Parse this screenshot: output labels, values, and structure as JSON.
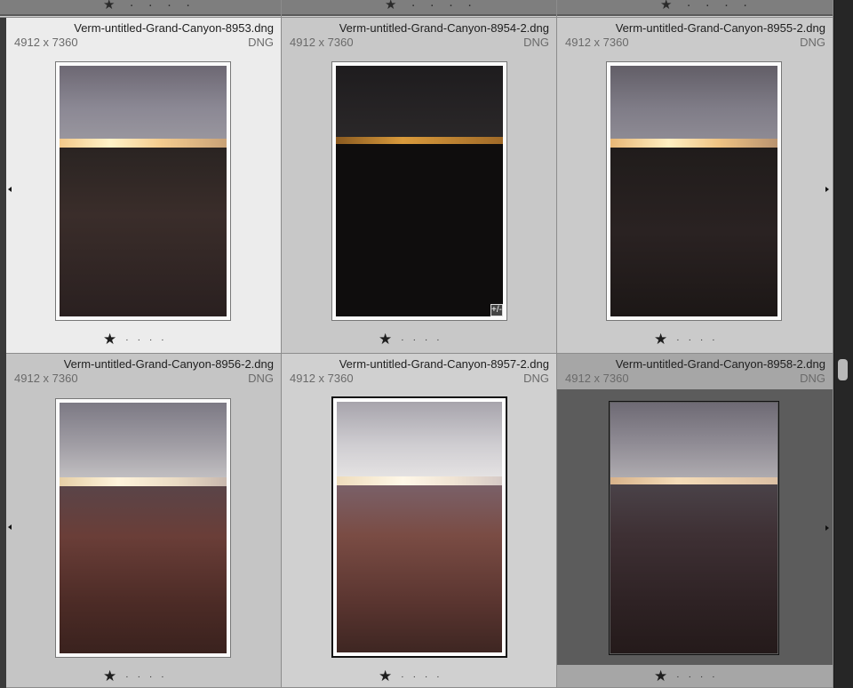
{
  "grid": {
    "row1": [
      {
        "filename": "Verm-untitled-Grand-Canyon-8953.dng",
        "dimensions": "4912 x 7360",
        "type": "DNG",
        "rating_star": "★",
        "rating_dots": [
          "·",
          "·",
          "·",
          "·"
        ]
      },
      {
        "filename": "Verm-untitled-Grand-Canyon-8954-2.dng",
        "dimensions": "4912 x 7360",
        "type": "DNG",
        "rating_star": "★",
        "rating_dots": [
          "·",
          "·",
          "·",
          "·"
        ],
        "badge": "+/-"
      },
      {
        "filename": "Verm-untitled-Grand-Canyon-8955-2.dng",
        "dimensions": "4912 x 7360",
        "type": "DNG",
        "rating_star": "★",
        "rating_dots": [
          "·",
          "·",
          "·",
          "·"
        ]
      }
    ],
    "row2": [
      {
        "filename": "Verm-untitled-Grand-Canyon-8956-2.dng",
        "dimensions": "4912 x 7360",
        "type": "DNG",
        "rating_star": "★",
        "rating_dots": [
          "·",
          "·",
          "·",
          "·"
        ]
      },
      {
        "filename": "Verm-untitled-Grand-Canyon-8957-2.dng",
        "dimensions": "4912 x 7360",
        "type": "DNG",
        "rating_star": "★",
        "rating_dots": [
          "·",
          "·",
          "·",
          "·"
        ]
      },
      {
        "filename": "Verm-untitled-Grand-Canyon-8958-2.dng",
        "dimensions": "4912 x 7360",
        "type": "DNG",
        "rating_star": "★",
        "rating_dots": [
          "·",
          "·",
          "·",
          "·"
        ]
      }
    ],
    "prev_row_rating": [
      "★ · · · ·",
      "★ · · · ·",
      "★ · · · ·"
    ]
  },
  "colors": {
    "cell_light": "#ececec",
    "cell_mid": "#c8c8c8",
    "cell_dark": "#5c5c5c",
    "accent_sun": "#f5c66a"
  },
  "icons": {
    "rotate_left": "arrow-left-icon",
    "rotate_right": "arrow-right-icon",
    "edit_badge": "develop-adjusted-icon",
    "star": "star-icon"
  }
}
